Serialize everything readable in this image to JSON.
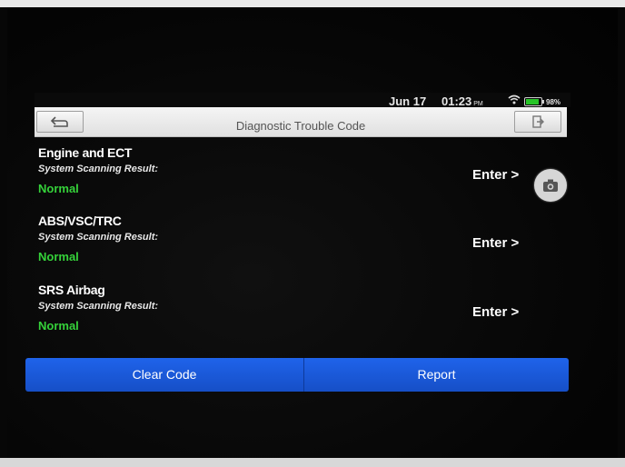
{
  "status": {
    "date": "Jun 17",
    "time": "01:23",
    "ampm": "PM",
    "wifi_icon": "wifi-icon",
    "battery_icon": "battery-icon",
    "battery_level": 0.9,
    "battery_text": "98%"
  },
  "header": {
    "title": "Diagnostic Trouble Code",
    "back_icon": "back-arrow-icon",
    "exit_icon": "exit-icon"
  },
  "systems": [
    {
      "name": "Engine and ECT",
      "result_label": "System Scanning Result:",
      "status": "Normal",
      "action": "Enter >"
    },
    {
      "name": "ABS/VSC/TRC",
      "result_label": "System Scanning Result:",
      "status": "Normal",
      "action": "Enter >"
    },
    {
      "name": "SRS Airbag",
      "result_label": "System Scanning Result:",
      "status": "Normal",
      "action": "Enter >"
    }
  ],
  "footer": {
    "clear_label": "Clear Code",
    "report_label": "Report"
  },
  "colors": {
    "status_normal": "#35d23a",
    "bottom_bar": "#1f63ea",
    "battery": "#27c427"
  },
  "camera_icon": "camera-icon"
}
